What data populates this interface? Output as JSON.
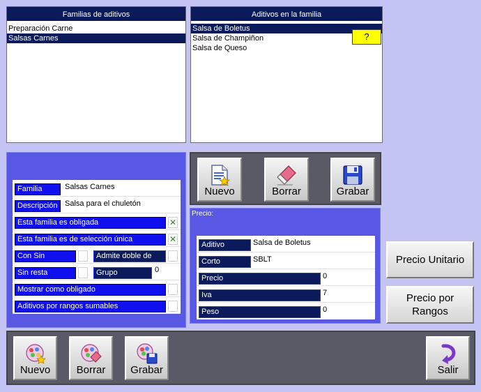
{
  "families": {
    "header": "Familias de aditivos",
    "items": [
      "Preparación Carne",
      "Salsas Carnes"
    ],
    "selected_index": 1
  },
  "additives": {
    "header": "Aditivos en la familia",
    "items": [
      "Salsa de Boletus",
      "Salsa de Champiñon",
      "Salsa de Queso"
    ],
    "selected_index": 0,
    "help_label": "?"
  },
  "family_form": {
    "familia_label": "Familia",
    "familia_value": "Salsas Carnes",
    "descripcion_label": "Descripción",
    "descripcion_value": "Salsa para el chuletón",
    "obligada_label": "Esta familia es obligada",
    "obligada_checked": true,
    "seleccion_unica_label": "Esta familia es de selección única",
    "seleccion_unica_checked": true,
    "con_sin_label": "Con Sin",
    "admite_doble_label": "Admite doble de",
    "sin_resta_label": "Sin resta",
    "grupo_label": "Grupo",
    "grupo_value": "0",
    "mostrar_obligado_label": "Mostrar como obligado",
    "rangos_sumables_label": "Aditivos por rangos sumables",
    "check_mark": "✕"
  },
  "additive_toolbar": {
    "nuevo_label": "Nuevo",
    "borrar_label": "Borrar",
    "grabar_label": "Grabar"
  },
  "price_panel": {
    "title": "Precio:",
    "aditivo_label": "Aditivo",
    "aditivo_value": "Salsa de Boletus",
    "corto_label": "Corto",
    "corto_value": "SBLT",
    "precio_label": "Precio",
    "precio_value": "0",
    "iva_label": "Iva",
    "iva_value": "7",
    "peso_label": "Peso",
    "peso_value": "0"
  },
  "side_buttons": {
    "precio_unitario": "Precio Unitario",
    "precio_por_rangos_line1": "Precio por",
    "precio_por_rangos_line2": "Rangos"
  },
  "bottom_toolbar": {
    "nuevo_label": "Nuevo",
    "borrar_label": "Borrar",
    "grabar_label": "Grabar",
    "salir_label": "Salir"
  }
}
